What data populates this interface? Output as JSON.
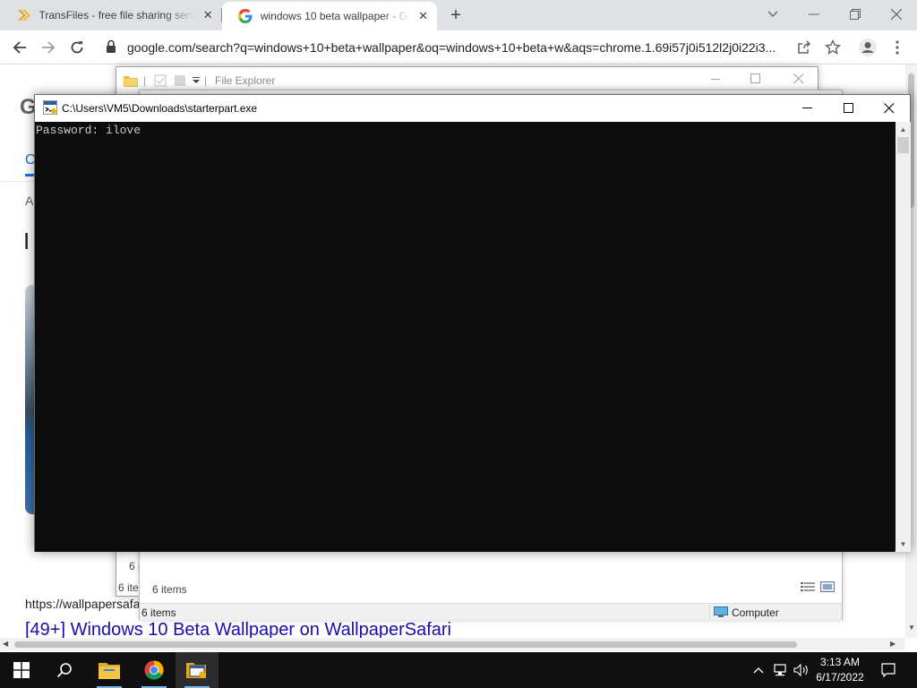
{
  "browser": {
    "tabs": [
      {
        "title": "TransFiles - free file sharing servi",
        "favicon": "transfiles-chevron-icon",
        "active": false
      },
      {
        "title": "windows 10 beta wallpaper - Goo",
        "favicon": "google-g-icon",
        "active": true
      }
    ],
    "url": "google.com/search?q=windows+10+beta+wallpaper&oq=windows+10+beta+w&aqs=chrome.1.69i57j0i512l2j0i22i3..."
  },
  "page": {
    "fragments": {
      "logo_letter": "G",
      "tab_letter": "O",
      "small_letter": "A",
      "heading_letter": "I"
    },
    "result": {
      "url": "https://wallpapersafa",
      "title": "[49+] Windows 10 Beta Wallpaper on WallpaperSafari"
    }
  },
  "file_explorer": {
    "title": "File Explorer",
    "status_items": "6 items",
    "status_items_cut": "6 i",
    "status_items_cut2": "6 ite",
    "location": "Computer"
  },
  "console": {
    "title": "C:\\Users\\VM5\\Downloads\\starterpart.exe",
    "output": "Password: ilove"
  },
  "taskbar": {
    "time": "3:13 AM",
    "date": "6/17/2022",
    "apps": [
      "windows-start-icon",
      "search-icon",
      "file-explorer-icon",
      "chrome-icon",
      "console-app-icon"
    ]
  },
  "colors": {
    "console_bg": "#0c0c0c",
    "console_text": "#cccccc",
    "link": "#1a0dab",
    "taskbar": "#101010",
    "tab_strip": "#dee1e6"
  }
}
